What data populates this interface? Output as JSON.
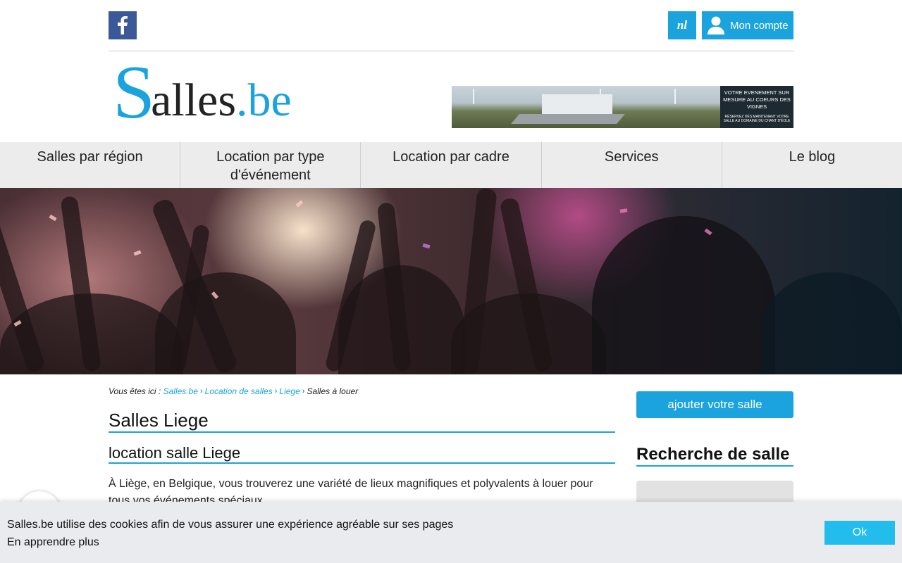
{
  "header": {
    "facebook_icon": "facebook-icon",
    "language_label": "nl",
    "account_label": "Mon compte",
    "account_icon": "user-icon"
  },
  "logo": {
    "s": "S",
    "alles": "alles",
    "dot": ".",
    "be": "be"
  },
  "ad": {
    "line1": "VOTRE EVENEMENT SUR MESURE AU COEURS DES VIGNES",
    "line2": "RÉSERVEZ DÈS MAINTENANT VOTRE SALLE AU DOMAINE DU CHANT D'ÉOLE"
  },
  "nav": {
    "items": [
      {
        "label": "Salles par région"
      },
      {
        "label": "Location par type d'événement"
      },
      {
        "label": "Location par cadre"
      },
      {
        "label": "Services"
      },
      {
        "label": "Le blog"
      }
    ]
  },
  "breadcrumb": {
    "prefix": "Vous êtes ici :",
    "links": [
      "Salles.be",
      "Location de salles",
      "Liege"
    ],
    "current": "Salles à louer"
  },
  "main": {
    "title": "Salles Liege",
    "subtitle": "location salle Liege",
    "intro": "À Liège, en Belgique, vous trouverez une variété de lieux magnifiques et polyvalents à louer pour tous vos événements spéciaux"
  },
  "sidebar": {
    "add_button": "ajouter votre salle",
    "search_title": "Recherche de salle"
  },
  "cookie": {
    "message": "Salles.be utilise des cookies afin de vous assurer une expérience agréable sur ses pages",
    "learn_more": "En apprendre plus",
    "ok_label": "Ok"
  },
  "colors": {
    "accent": "#1aa3dd",
    "facebook": "#3b5998",
    "nav_bg": "#ececec",
    "cookie_bg": "#e9ebee",
    "cookie_ok": "#22bdec"
  }
}
